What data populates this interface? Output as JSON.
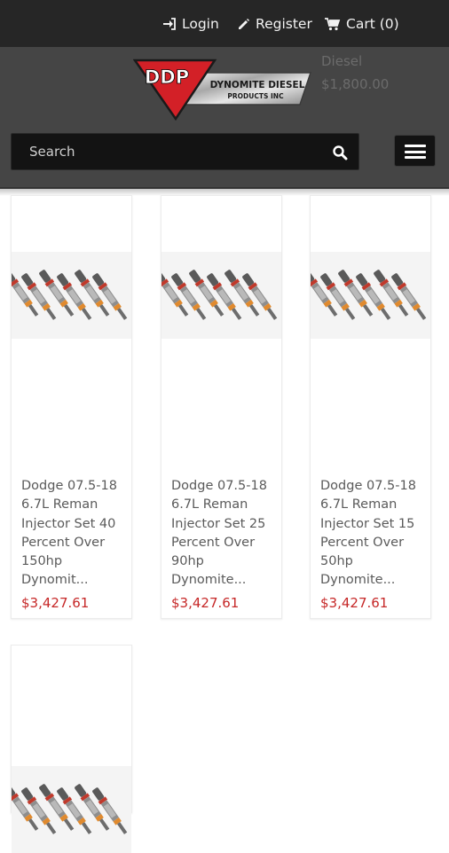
{
  "topbar": {
    "login_label": "Login",
    "register_label": "Register",
    "cart_label": "Cart (0)"
  },
  "header": {
    "logo_text_main": "DDP",
    "logo_text_line1": "DYNOMITE DIESEL",
    "logo_text_line2": "PRODUCTS INC",
    "behind_text": "Diesel",
    "behind_price": "$1,800.00"
  },
  "search": {
    "placeholder": "Search"
  },
  "products": [
    {
      "title": "Dodge 07.5-18 6.7L Reman Injector Set 40 Percent Over 150hp Dynomit...",
      "price": "$3,427.61"
    },
    {
      "title": "Dodge 07.5-18 6.7L Reman Injector Set 25 Percent Over 90hp Dynomite...",
      "price": "$3,427.61"
    },
    {
      "title": "Dodge 07.5-18 6.7L Reman Injector Set 15 Percent Over 50hp Dynomite...",
      "price": "$3,427.61"
    }
  ],
  "colors": {
    "topbar": "#262626",
    "header": "#454545",
    "price": "#c62828",
    "logo_red": "#d32027"
  }
}
